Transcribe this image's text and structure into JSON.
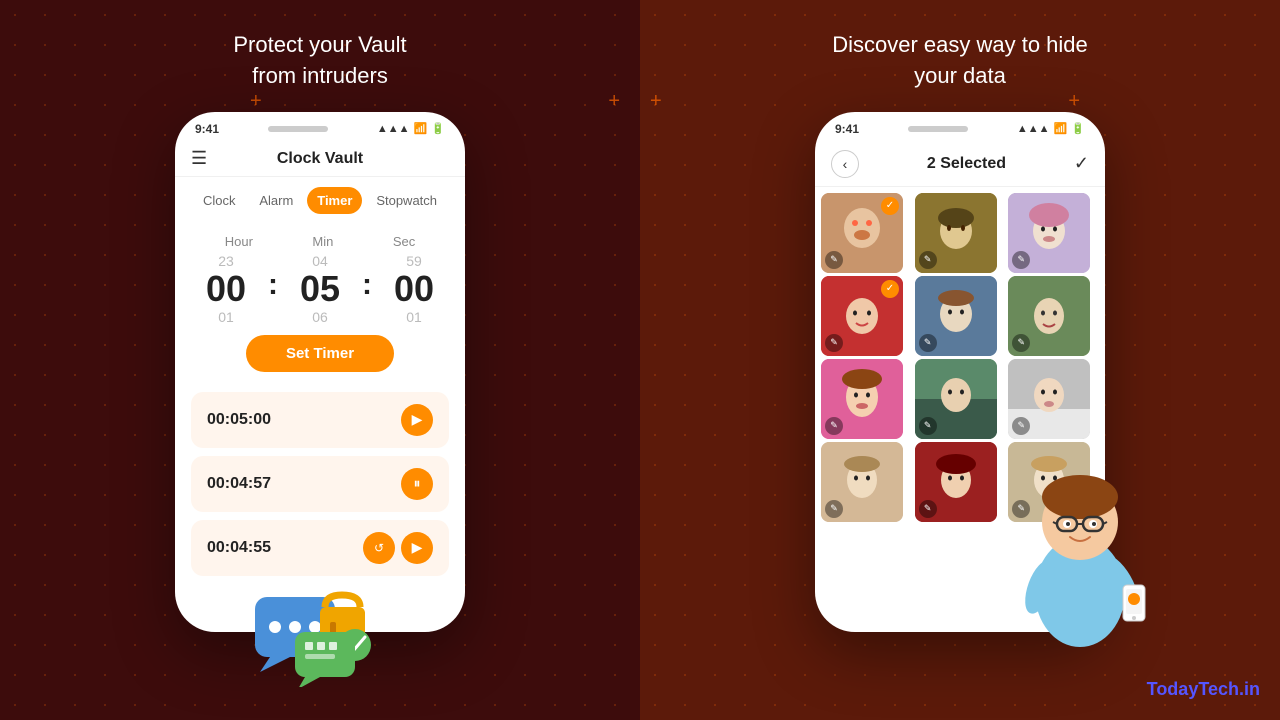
{
  "left": {
    "title": "Protect your Vault\nfrom intruders",
    "phone": {
      "status_time": "9:41",
      "app_title": "Clock Vault",
      "tabs": [
        "Clock",
        "Alarm",
        "Timer",
        "Stopwatch"
      ],
      "active_tab": "Timer",
      "timer": {
        "labels": [
          "Hour",
          "Min",
          "Sec"
        ],
        "above": [
          "23",
          "04",
          "59"
        ],
        "main": [
          "00",
          "05",
          "00"
        ],
        "below": [
          "01",
          "06",
          "01"
        ]
      },
      "set_timer_label": "Set Timer",
      "timer_items": [
        {
          "time": "00:05:00",
          "icon": "play"
        },
        {
          "time": "00:04:57",
          "icon": "pause"
        },
        {
          "time": "00:04:55",
          "icons": [
            "reset",
            "play"
          ]
        }
      ]
    }
  },
  "right": {
    "title": "Discover easy way to hide\nyour data",
    "phone": {
      "status_time": "9:41",
      "selected_text": "2 Selected",
      "photos": [
        {
          "id": 1,
          "selected": true,
          "class": "photo-1"
        },
        {
          "id": 2,
          "selected": false,
          "class": "photo-2"
        },
        {
          "id": 3,
          "selected": false,
          "class": "photo-3"
        },
        {
          "id": 4,
          "selected": true,
          "class": "photo-4"
        },
        {
          "id": 5,
          "selected": false,
          "class": "photo-5"
        },
        {
          "id": 6,
          "selected": false,
          "class": "photo-6"
        },
        {
          "id": 7,
          "selected": false,
          "class": "photo-7"
        },
        {
          "id": 8,
          "selected": false,
          "class": "photo-8"
        },
        {
          "id": 9,
          "selected": false,
          "class": "photo-9"
        },
        {
          "id": 10,
          "selected": false,
          "class": "photo-10"
        },
        {
          "id": 11,
          "selected": false,
          "class": "photo-11"
        },
        {
          "id": 12,
          "selected": false,
          "class": "photo-12"
        }
      ]
    }
  },
  "brand": "TodayTech.in"
}
